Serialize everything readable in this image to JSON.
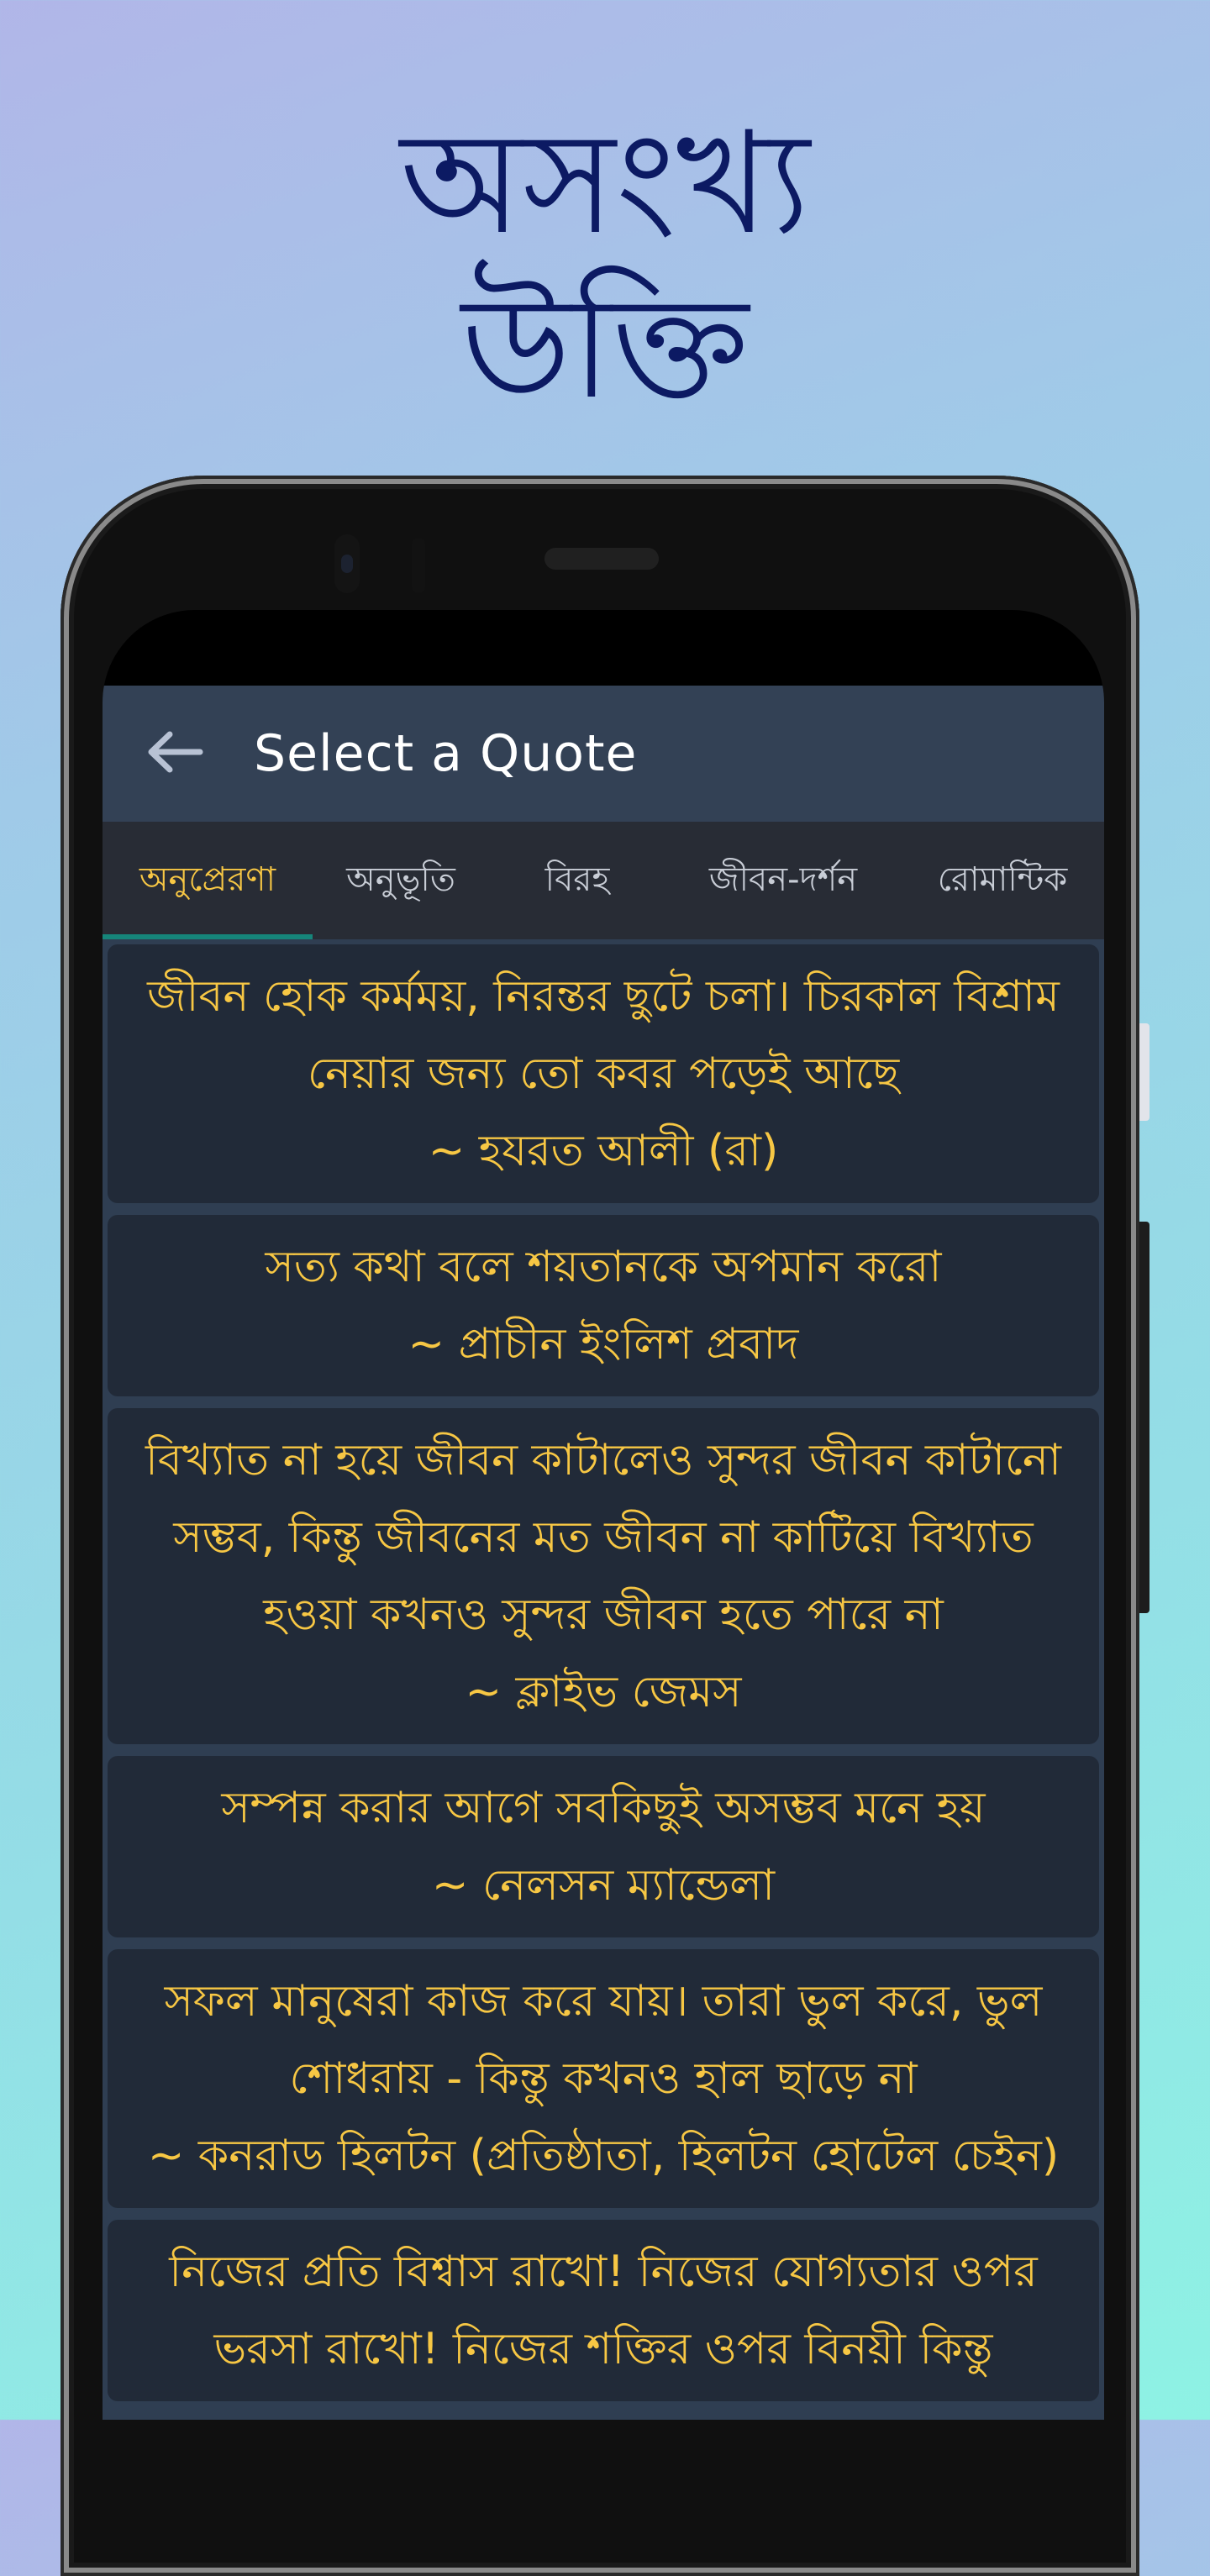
{
  "headline": {
    "line1": "অসংখ্য",
    "line2": "উক্তি"
  },
  "colors": {
    "accent": "#f7c744",
    "indicator": "#16857a",
    "appbar": "#334155",
    "tabbar": "#282c35",
    "card": "#212a38"
  },
  "appbar": {
    "back_icon": "arrow-left-icon",
    "title": "Select a Quote"
  },
  "tabs": [
    {
      "label": "অনুপ্রেরণা",
      "active": true
    },
    {
      "label": "অনুভূতি",
      "active": false
    },
    {
      "label": "বিরহ",
      "active": false
    },
    {
      "label": "জীবন-দর্শন",
      "active": false
    },
    {
      "label": "রোমান্টিক",
      "active": false
    }
  ],
  "quotes": [
    {
      "text": "জীবন হোক কর্মময়, নিরন্তর ছুটে চলা। চিরকাল বিশ্রাম নেয়ার জন্য তো কবর পড়েই আছে",
      "author": "~ হযরত আলী (রা)"
    },
    {
      "text": "সত্য কথা বলে শয়তানকে অপমান করো",
      "author": "~ প্রাচীন ইংলিশ প্রবাদ"
    },
    {
      "text": "বিখ্যাত না হয়ে জীবন কাটালেও সুন্দর জীবন কাটানো সম্ভব, কিন্তু জীবনের মত জীবন না কাটিয়ে বিখ্যাত হওয়া কখনও সুন্দর জীবন হতে পারে না",
      "author": "~ ক্লাইভ জেমস"
    },
    {
      "text": "সম্পন্ন করার আগে সবকিছুই অসম্ভব মনে হয়",
      "author": "~ নেলসন ম্যান্ডেলা"
    },
    {
      "text": "সফল মানুষেরা কাজ করে যায়। তারা ভুল করে, ভুল শোধরায় - কিন্তু কখনও হাল ছাড়ে না",
      "author": "~ কনরাড হিলটন (প্রতিষ্ঠাতা, হিলটন হোটেল চেইন)"
    },
    {
      "text": "নিজের প্রতি বিশ্বাস রাখো! নিজের যোগ্যতার ওপর ভরসা রাখো! নিজের শক্তির ওপর বিনয়ী কিন্তু",
      "author": ""
    }
  ]
}
